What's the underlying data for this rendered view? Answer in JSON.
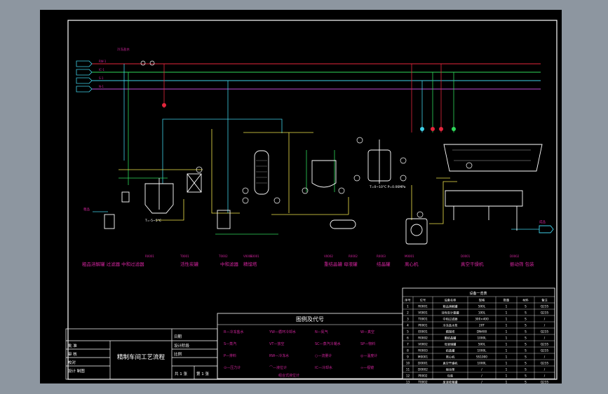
{
  "title_block": {
    "drawing_title": "精制车间工艺流程",
    "left_labels": [
      "批 准",
      "审 核",
      "校对",
      "设计 制图"
    ],
    "right_labels": [
      "日期",
      "设计阶段",
      "比例"
    ],
    "sheet_count": "共 1 张",
    "sheet_no": "第 1 张"
  },
  "legend": {
    "title": "图例及代号",
    "items": [
      "R—冷冻盐水",
      "YW—循环冷却水",
      "N—氮气",
      "W—真空",
      "S—蒸汽",
      "VT—放空",
      "SC—蒸汽冷凝水",
      "SP—物料",
      "P—排料",
      "RW—冷冻水",
      "○—流量计",
      "◎—温度计",
      "⊙—压力计",
      "⌒—液位计",
      "IC—冷却水",
      "∞—视镜"
    ],
    "extra_label": "组合式液位计"
  },
  "equipment_table": {
    "title": "设备一览表",
    "headers": [
      "序号",
      "位号",
      "设备名称",
      "规格",
      "数量",
      "材料",
      "备注"
    ],
    "rows": [
      [
        "1",
        "R0001",
        "粗品溶解罐",
        "500L",
        "1",
        "S",
        "Q235"
      ],
      [
        "2",
        "V0001",
        "活性炭计量罐",
        "100L",
        "1",
        "S",
        "Q235"
      ],
      [
        "3",
        "T0001",
        "中和过滤器",
        "300×400",
        "1",
        "S",
        "/"
      ],
      [
        "4",
        "P0001",
        "冷冻盐水泵",
        "20T",
        "1",
        "S",
        "/"
      ],
      [
        "5",
        "E0001",
        "精馏塔",
        "DN400",
        "1",
        "S",
        "Q235"
      ],
      [
        "6",
        "R0002",
        "重结晶罐",
        "1000L",
        "1",
        "S",
        "/"
      ],
      [
        "7",
        "V0002",
        "母液储罐",
        "500L",
        "1",
        "S",
        "Q235"
      ],
      [
        "8",
        "R0003",
        "结晶罐",
        "1000L",
        "1",
        "S",
        "Q235"
      ],
      [
        "9",
        "M0001",
        "离心机",
        "SS1000",
        "1",
        "S",
        "/"
      ],
      [
        "10",
        "D0001",
        "真空干燥机",
        "1000L",
        "1",
        "S",
        "Q235"
      ],
      [
        "11",
        "D0002",
        "振动筛",
        "/",
        "1",
        "S",
        "/"
      ],
      [
        "12",
        "P0002",
        "包装",
        "/",
        "1",
        "S",
        "/"
      ],
      [
        "13",
        "T0002",
        "废液收集罐",
        "/",
        "1",
        "S",
        "Q235"
      ]
    ]
  },
  "utility_lines": {
    "labels": [
      "冷冻盐水",
      "循环水",
      "蒸汽",
      "氮气"
    ],
    "tags": [
      "RW-1",
      "IC-1",
      "S-1",
      "N-1"
    ],
    "colors": [
      "#e3263c",
      "#2fd85a",
      "#3fd0e8",
      "#c050d8"
    ]
  },
  "equipment_captions": [
    "粗品溶解罐 过滤器 中和过滤器",
    "活性炭罐",
    "中和滤器",
    "精馏塔",
    "重结晶罐 母液罐",
    "结晶罐",
    "离心机",
    "真空干燥机",
    "振动筛 包装"
  ],
  "equipment_tags": [
    "R0001",
    "T0001",
    "T0002",
    "V0001",
    "E0001",
    "V0002",
    "R0002",
    "R0003",
    "M0001",
    "D0001",
    "D0002"
  ],
  "annotations": {
    "temp_note_1": "T=-5~5°C",
    "temp_note_2": "T=0~10°C P=0.06MPa",
    "feed_label": "粗品",
    "product_label": "成品"
  },
  "colors": {
    "background": "#000000",
    "frame": "#ffffff",
    "refrigerant": "#e3263c",
    "cooling_water": "#2fd85a",
    "steam": "#3fd0e8",
    "nitrogen": "#c050d8",
    "material": "#f2e44a",
    "caption": "#d0249c"
  }
}
